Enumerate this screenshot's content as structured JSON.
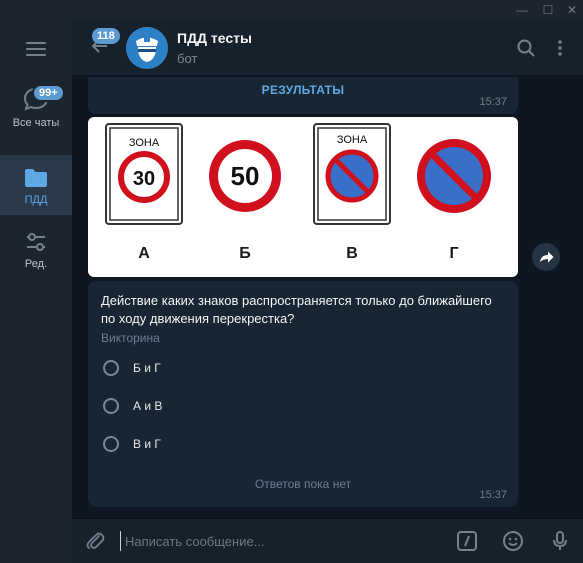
{
  "window": {
    "minimize": "—",
    "maximize": "☐",
    "close": "✕"
  },
  "sidebar": {
    "menu_icon": "hamburger-icon",
    "folders": [
      {
        "label": "Все чаты",
        "icon": "chat-bubble-icon",
        "badge": "99+"
      },
      {
        "label": "ПДД",
        "icon": "folder-icon",
        "active": true
      },
      {
        "label": "Ред.",
        "icon": "sliders-icon"
      }
    ]
  },
  "header": {
    "unread_count": "118",
    "title": "ПДД тесты",
    "subtitle": "бот",
    "icons": [
      "search-icon",
      "more-vertical-icon"
    ]
  },
  "messages": {
    "results_link": "РЕЗУЛЬТАТЫ",
    "results_time": "15:37",
    "image_labels": [
      "А",
      "Б",
      "В",
      "Г"
    ],
    "sign_texts": {
      "zone_a": "ЗОНА",
      "speed_a": "30",
      "speed_b": "50",
      "zone_v": "ЗОНА"
    },
    "quiz": {
      "question": "Действие каких знаков распространяется только до ближайшего по ходу движения перекрестка?",
      "type": "Викторина",
      "options": [
        "Б и Г",
        "А и В",
        "В и Г"
      ],
      "status": "Ответов пока нет",
      "time": "15:37"
    }
  },
  "composer": {
    "placeholder": "Написать сообщение...",
    "icons": [
      "paperclip-icon",
      "bot-command-icon",
      "emoji-icon",
      "microphone-icon"
    ]
  },
  "colors": {
    "accent": "#5fa8e6",
    "bubble": "#182533",
    "background": "#0e1621",
    "sidebar": "#1c242e"
  }
}
